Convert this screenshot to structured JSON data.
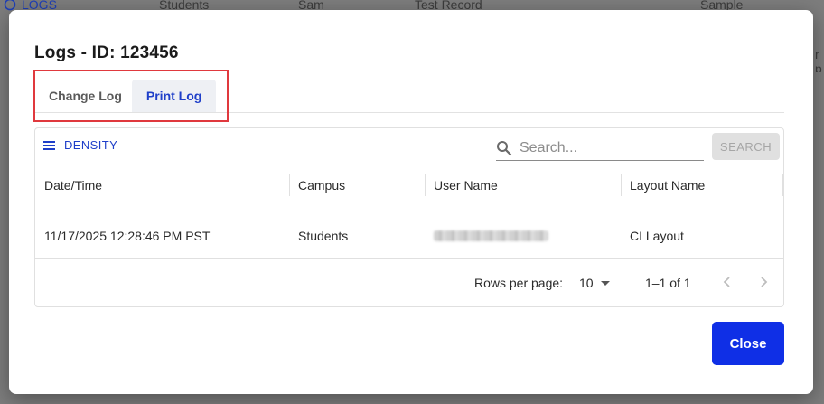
{
  "background": {
    "logs_link": "LOGS",
    "columns": [
      "Students",
      "Sam",
      "Test Record",
      "Sample"
    ],
    "side_fragment": "r p"
  },
  "modal": {
    "title": "Logs - ID: 123456",
    "tabs": [
      {
        "label": "Change Log",
        "active": false
      },
      {
        "label": "Print Log",
        "active": true
      }
    ],
    "toolbar": {
      "density_label": "DENSITY",
      "search_placeholder": "Search...",
      "search_button": "SEARCH"
    },
    "table": {
      "columns": [
        "Date/Time",
        "Campus",
        "User Name",
        "Layout Name"
      ],
      "rows": [
        {
          "datetime": "11/17/2025 12:28:46 PM PST",
          "campus": "Students",
          "user_name": "",
          "layout": "CI Layout"
        }
      ]
    },
    "pagination": {
      "rows_per_page_label": "Rows per page:",
      "rows_per_page_value": "10",
      "range": "1–1 of 1"
    },
    "close_label": "Close"
  },
  "colors": {
    "accent": "#1f3fc9",
    "primary_button": "#0f2fe6",
    "highlight": "#e0393e"
  }
}
